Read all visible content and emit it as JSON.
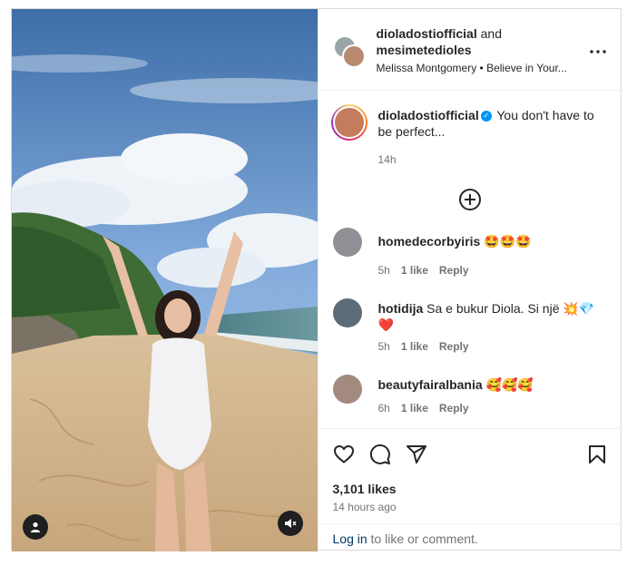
{
  "post": {
    "authors_primary": "diolados tiofficial",
    "author1": "dioladostiofficial",
    "and_word": " and ",
    "author2": "mesimetedioles",
    "music": "Melissa Montgomery • Believe in Your...",
    "more_icon": "more-horizontal-icon"
  },
  "caption": {
    "user": "dioladostiofficial",
    "text": " You don't have to be perfect...",
    "time": "14h"
  },
  "load_more_icon": "plus-circle-icon",
  "comments": [
    {
      "user": "homedecorbyiris",
      "text": " 🤩🤩🤩",
      "time": "5h",
      "likes": "1 like",
      "reply": "Reply"
    },
    {
      "user": "hotidija",
      "text": " Sa e bukur Diola. Si një 💥💎❤️",
      "time": "5h",
      "likes": "1 like",
      "reply": "Reply"
    },
    {
      "user": "beautyfairalbania",
      "text": " 🥰🥰🥰",
      "time": "6h",
      "likes": "1 like",
      "reply": "Reply"
    }
  ],
  "actions": {
    "like_icon": "heart-icon",
    "comment_icon": "comment-icon",
    "share_icon": "send-icon",
    "save_icon": "bookmark-icon",
    "likes": "3,101 likes",
    "time": "14 hours ago"
  },
  "login": {
    "link": "Log in",
    "text": " to like or comment."
  },
  "media": {
    "user_tag_icon": "user-icon",
    "mute_icon": "muted-speaker-icon"
  }
}
